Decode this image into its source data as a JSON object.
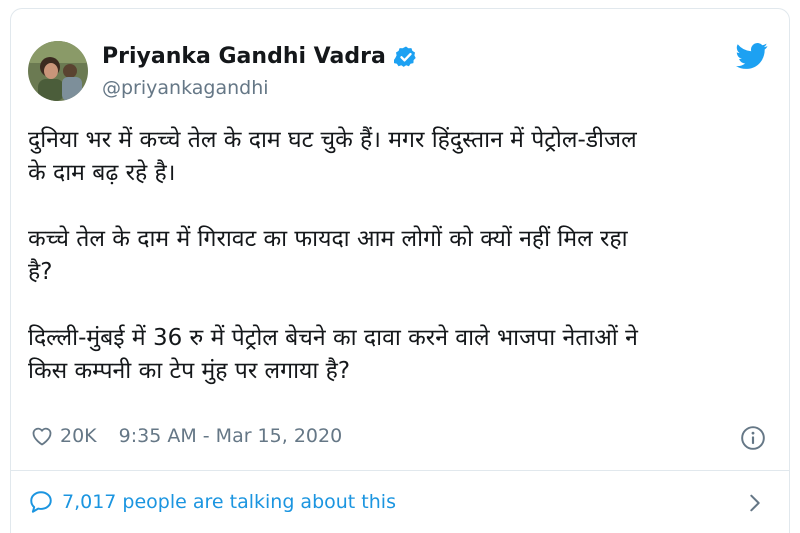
{
  "tweet": {
    "author_name": "Priyanka Gandhi Vadra",
    "handle": "@priyankagandhi",
    "paragraphs": [
      "दुनिया भर में कच्चे तेल के दाम घट चुके हैं। मगर हिंदुस्तान में पेट्रोल-डीजल\nके दाम बढ़ रहे है।",
      "कच्चे तेल के दाम में गिरावट का फायदा आम लोगों को क्यों नहीं मिल रहा\nहै?",
      "दिल्ली-मुंबई में 36 रु में पेट्रोल बेचने का दावा करने वाले भाजपा नेताओं ने\nकिस कम्पनी का टेप मुंह पर लगाया है?"
    ],
    "likes": "20K",
    "timestamp": "9:35 AM - Mar 15, 2020",
    "talking_about": "7,017 people are talking about this"
  },
  "icons": {
    "verified": "verified-badge-icon",
    "logo": "twitter-bird-icon",
    "like": "heart-icon",
    "info": "info-icon",
    "comments": "speech-bubble-icon",
    "more": "chevron-right-icon"
  },
  "colors": {
    "brand_blue": "#1da1f2",
    "link_blue": "#1b95e0",
    "text_primary": "#14171a",
    "text_secondary": "#657786",
    "border": "#e1e8ed"
  }
}
